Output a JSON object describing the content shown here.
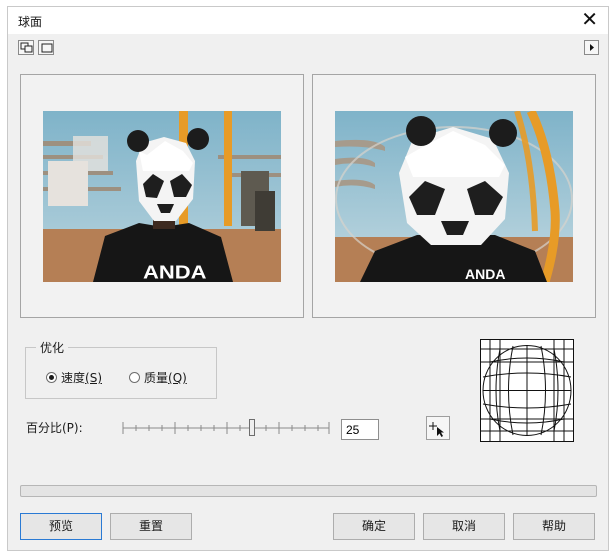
{
  "window": {
    "title": "球面",
    "close_glyph": "✕"
  },
  "toolbar": {
    "icons": [
      "two-panel-preview-icon",
      "single-panel-preview-icon"
    ],
    "expand_icon": "play-right-icon"
  },
  "previews": {
    "before_icon": "original-photo",
    "after_icon": "spherized-photo"
  },
  "optimize": {
    "label": "优化",
    "options": [
      {
        "label": "速度",
        "mnemonic": "(S)",
        "selected": true
      },
      {
        "label": "质量",
        "mnemonic": "(Q)",
        "selected": false
      }
    ]
  },
  "percentage": {
    "label": "百分比(P):",
    "value": "25",
    "slider_fraction": 0.625
  },
  "buttons": {
    "preview": "预览",
    "reset": "重置",
    "ok": "确定",
    "cancel": "取消",
    "help": "帮助"
  },
  "colors": {
    "accent": "#2a7ad4",
    "dialog_bg": "#f0f0f0",
    "border": "#a5a5a5"
  }
}
